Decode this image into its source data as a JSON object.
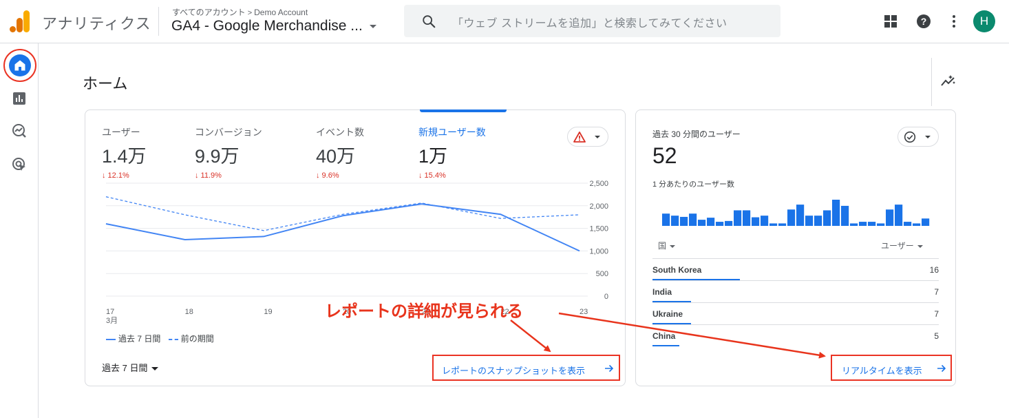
{
  "topbar": {
    "app_name": "アナリティクス",
    "breadcrumb_root": "すべてのアカウント",
    "breadcrumb_sep": ">",
    "breadcrumb_account": "Demo Account",
    "property_name": "GA4 - Google Merchandise ...",
    "search_placeholder": "「ウェブ ストリームを追加」と検索してみてください",
    "avatar_initial": "H"
  },
  "page": {
    "title": "ホーム"
  },
  "metrics": [
    {
      "label": "ユーザー",
      "value": "1.4万",
      "change": "↓ 12.1%"
    },
    {
      "label": "コンバージョン",
      "value": "9.9万",
      "change": "↓ 11.9%"
    },
    {
      "label": "イベント数",
      "value": "40万",
      "change": "↓ 9.6%"
    },
    {
      "label": "新規ユーザー数",
      "value": "1万",
      "change": "↓ 15.4%"
    }
  ],
  "chart_data": {
    "type": "line",
    "x": [
      "17",
      "18",
      "19",
      "20",
      "21",
      "22",
      "23"
    ],
    "x_sublabel": "3月",
    "series": [
      {
        "name": "過去 7 日間",
        "values": [
          1600,
          1250,
          1320,
          1780,
          2040,
          1810,
          1000
        ]
      },
      {
        "name": "前の期間",
        "values": [
          2200,
          1800,
          1450,
          1810,
          2060,
          1720,
          1800
        ]
      }
    ],
    "y_ticks": [
      "2,500",
      "2,000",
      "1,500",
      "1,000",
      "500",
      "0"
    ],
    "ylim": [
      0,
      2500
    ]
  },
  "legend": {
    "current": "過去 7 日間",
    "previous": "前の期間"
  },
  "range": {
    "label": "過去 7 日間"
  },
  "links": {
    "snapshot": "レポートのスナップショットを表示",
    "realtime": "リアルタイムを表示"
  },
  "realtime": {
    "title": "過去 30 分間のユーザー",
    "value": "52",
    "subtitle": "1 分あたりのユーザー数",
    "minute_bars": [
      3,
      2.5,
      2.2,
      3,
      1.5,
      2,
      1,
      1.2,
      3.8,
      3.8,
      2.1,
      2.5,
      0.6,
      0.6,
      4,
      5.2,
      2.5,
      2.5,
      3.8,
      6.4,
      4.9,
      0.6,
      1,
      1,
      0.6,
      4,
      5.2,
      1,
      0.6,
      1.8
    ],
    "col_country": "国",
    "col_users": "ユーザー",
    "rows": [
      {
        "country": "South Korea",
        "users": "16",
        "share": 1.0
      },
      {
        "country": "India",
        "users": "7",
        "share": 0.44
      },
      {
        "country": "Ukraine",
        "users": "7",
        "share": 0.44
      },
      {
        "country": "China",
        "users": "5",
        "share": 0.31
      }
    ]
  },
  "annotation": {
    "text": "レポートの詳細が見られる"
  }
}
